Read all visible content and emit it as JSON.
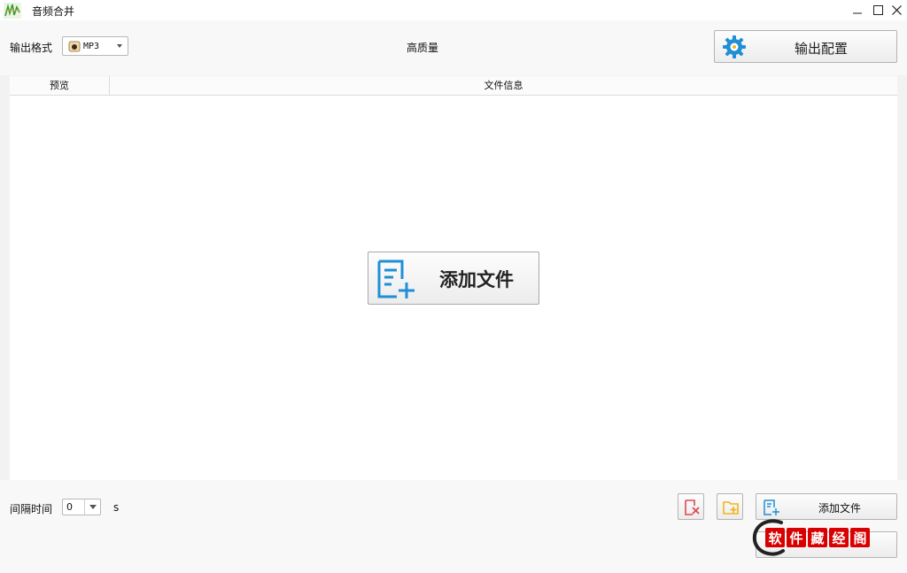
{
  "window": {
    "title": "音频合并",
    "app_icon": "audio-merge-app-icon",
    "controls": [
      "minimize",
      "maximize",
      "close"
    ]
  },
  "toolbar": {
    "format_label": "输出格式",
    "format_value": "MP3",
    "format_icon": "mp3-file-icon",
    "quality_label": "高质量",
    "config_button_label": "输出配置",
    "config_icon": "gear-icon"
  },
  "table": {
    "columns": [
      "预览",
      "文件信息"
    ],
    "rows": []
  },
  "center": {
    "add_button_label": "添加文件",
    "add_icon": "add-file-icon"
  },
  "bottom": {
    "interval_label": "间隔时间",
    "interval_value": "0",
    "interval_unit": "s",
    "delete_icon": "delete-file-icon",
    "add_folder_icon": "add-folder-icon",
    "add_file_button_label": "添加文件",
    "merge_button_label": ""
  },
  "watermark": {
    "text": "软件藏经阁"
  },
  "colors": {
    "accent_blue": "#1f8fd6",
    "delete_red": "#e0484f",
    "folder_yellow": "#f1b51c",
    "seal_red": "#d80000"
  }
}
